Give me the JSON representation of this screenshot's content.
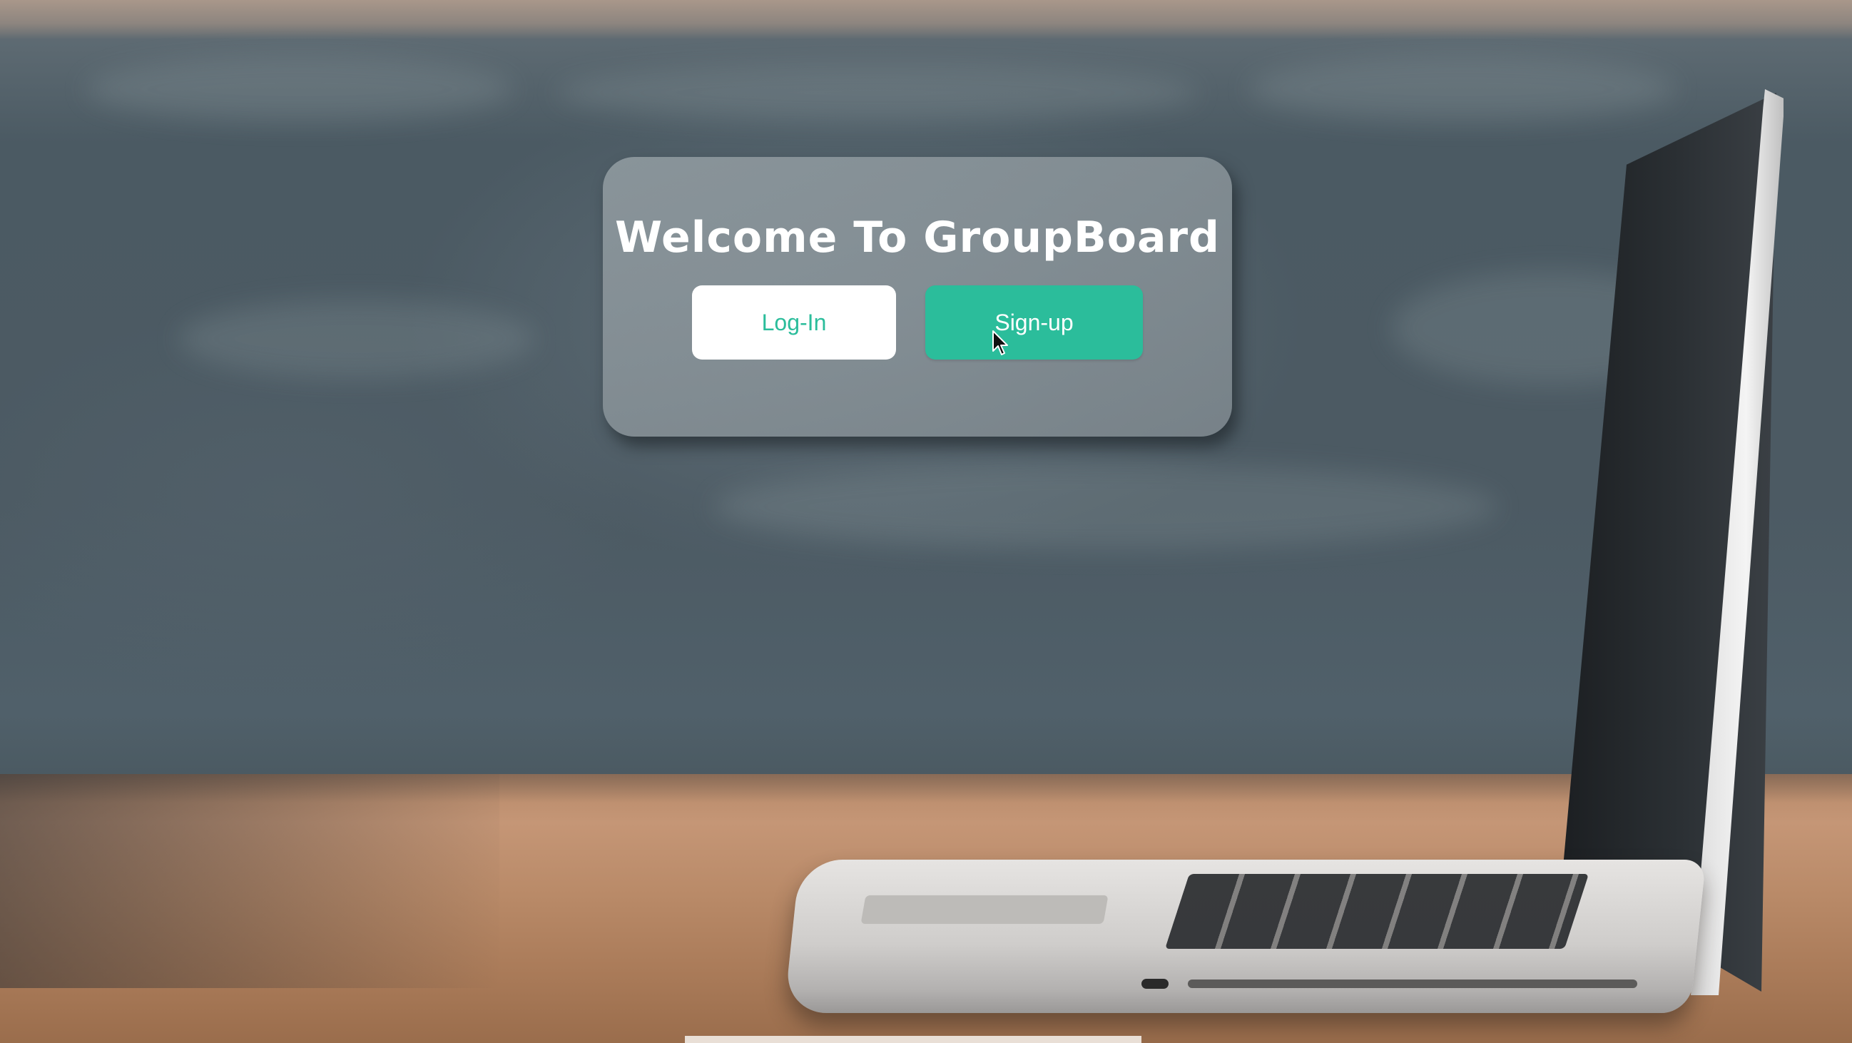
{
  "welcome": {
    "title": "Welcome To GroupBoard",
    "login_label": "Log-In",
    "signup_label": "Sign-up"
  },
  "colors": {
    "accent": "#2bbd9b",
    "login_bg": "#ffffff",
    "card_bg": "#8c979c"
  },
  "icons": {
    "cursor": "mouse-pointer-icon"
  }
}
